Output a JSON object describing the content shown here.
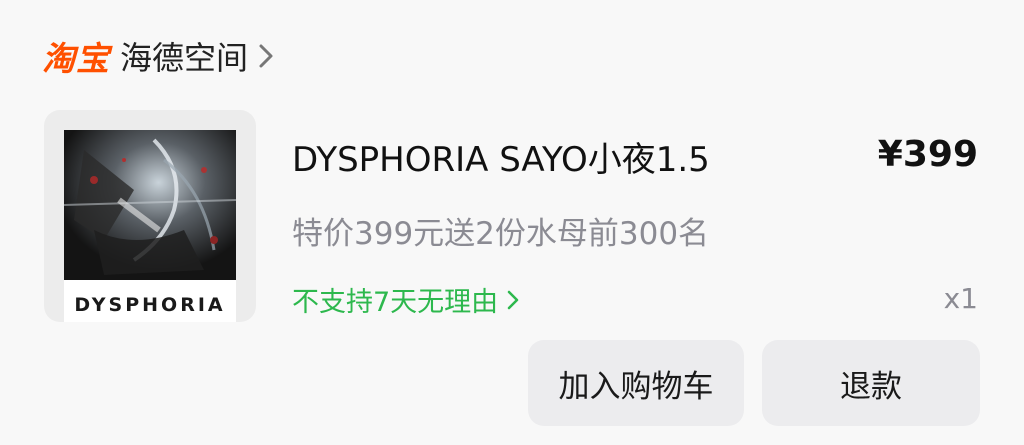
{
  "shop": {
    "platform_logo": "淘宝",
    "name": "海德空间"
  },
  "product": {
    "image_caption": "DYSPHORIA",
    "title": "DYSPHORIA SAYO小夜1.5",
    "price": "¥399",
    "subtitle": "特价399元送2份水母前300名",
    "policy": "不支持7天无理由",
    "quantity": "x1"
  },
  "actions": {
    "add_to_cart": "加入购物车",
    "refund": "退款"
  },
  "colors": {
    "brand": "#ff5000",
    "policy_green": "#2db84d",
    "muted_text": "#8b8b93"
  }
}
